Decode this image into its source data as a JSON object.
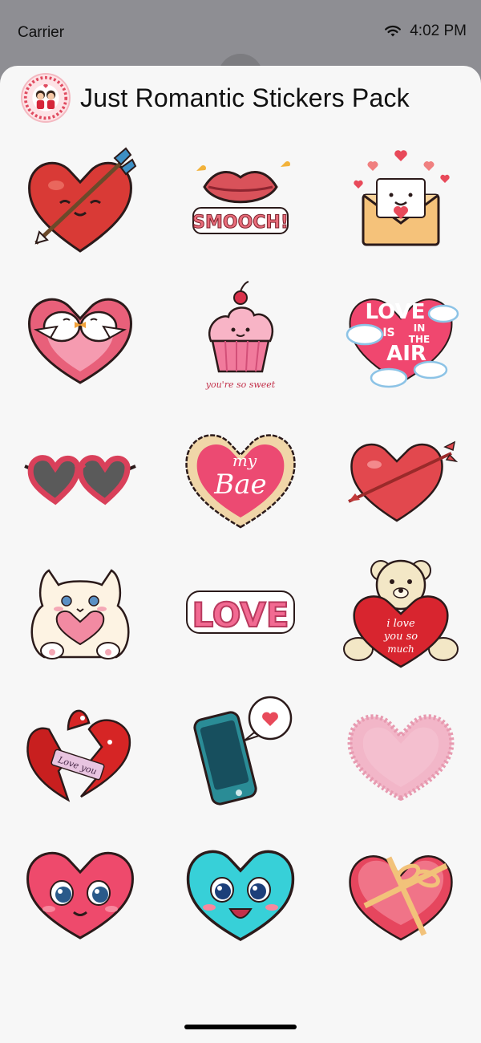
{
  "status_bar": {
    "carrier": "Carrier",
    "time": "4:02 PM",
    "wifi_icon": "wifi-icon"
  },
  "header": {
    "title": "Just Romantic Stickers Pack",
    "app_icon": "couple-app-icon"
  },
  "stickers": [
    {
      "name": "heart-with-arrow-sticker"
    },
    {
      "name": "smooch-lips-sticker",
      "text": "SMOOCH!"
    },
    {
      "name": "love-letter-envelope-sticker"
    },
    {
      "name": "lovebirds-heart-sticker"
    },
    {
      "name": "cupcake-sticker",
      "text": "you're so sweet"
    },
    {
      "name": "love-is-in-the-air-sticker",
      "text": "LOVE",
      "text2": "IS",
      "text3": "IN",
      "text4": "THE",
      "text5": "AIR"
    },
    {
      "name": "heart-sunglasses-sticker"
    },
    {
      "name": "my-bae-heart-sticker",
      "text": "my",
      "text2": "Bae"
    },
    {
      "name": "heart-pierced-by-arrow-sticker"
    },
    {
      "name": "fluffy-cat-with-heart-sticker"
    },
    {
      "name": "love-word-sticker",
      "text": "LOVE"
    },
    {
      "name": "teddy-bear-heart-sticker",
      "text": "i love",
      "text2": "you so",
      "text3": "much"
    },
    {
      "name": "broken-heart-sticker",
      "text": "Love you"
    },
    {
      "name": "phone-heart-message-sticker"
    },
    {
      "name": "fluffy-pink-heart-sticker"
    },
    {
      "name": "cute-pink-heart-face-sticker"
    },
    {
      "name": "cute-cyan-heart-face-sticker"
    },
    {
      "name": "heart-gift-box-sticker"
    }
  ],
  "colors": {
    "sheet_background": "#f7f7f7",
    "status_background": "#8e8e93",
    "love_pink": "#e8436b",
    "heart_red": "#d9302f"
  }
}
